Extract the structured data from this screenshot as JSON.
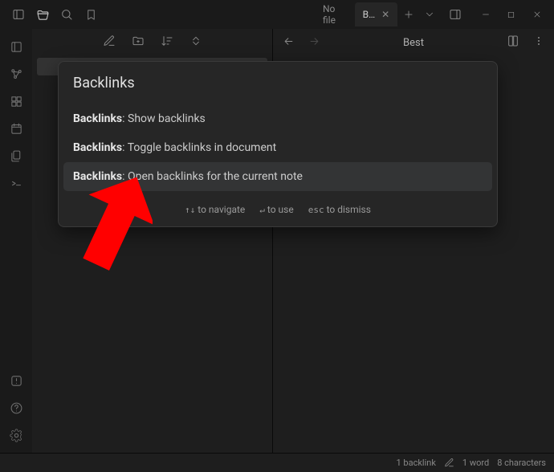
{
  "title_bar": {
    "tabs": [
      {
        "label": "No file",
        "active": false
      },
      {
        "label": "B…",
        "active": true
      }
    ]
  },
  "pane_right": {
    "title": "Best"
  },
  "palette": {
    "input_value": "Backlinks",
    "results": [
      {
        "prefix": "Backlinks",
        "rest": ": Show backlinks",
        "selected": false
      },
      {
        "prefix": "Backlinks",
        "rest": ": Toggle backlinks in document",
        "selected": false
      },
      {
        "prefix": "Backlinks",
        "rest": ": Open backlinks for the current note",
        "selected": true
      }
    ],
    "hints": {
      "navigate": "to navigate",
      "use": "to use",
      "dismiss": "to dismiss",
      "key_nav": "↑↓",
      "key_use": "↵",
      "key_dismiss": "esc"
    }
  },
  "status": {
    "backlinks": "1 backlink",
    "words": "1 word",
    "chars": "8 characters"
  }
}
